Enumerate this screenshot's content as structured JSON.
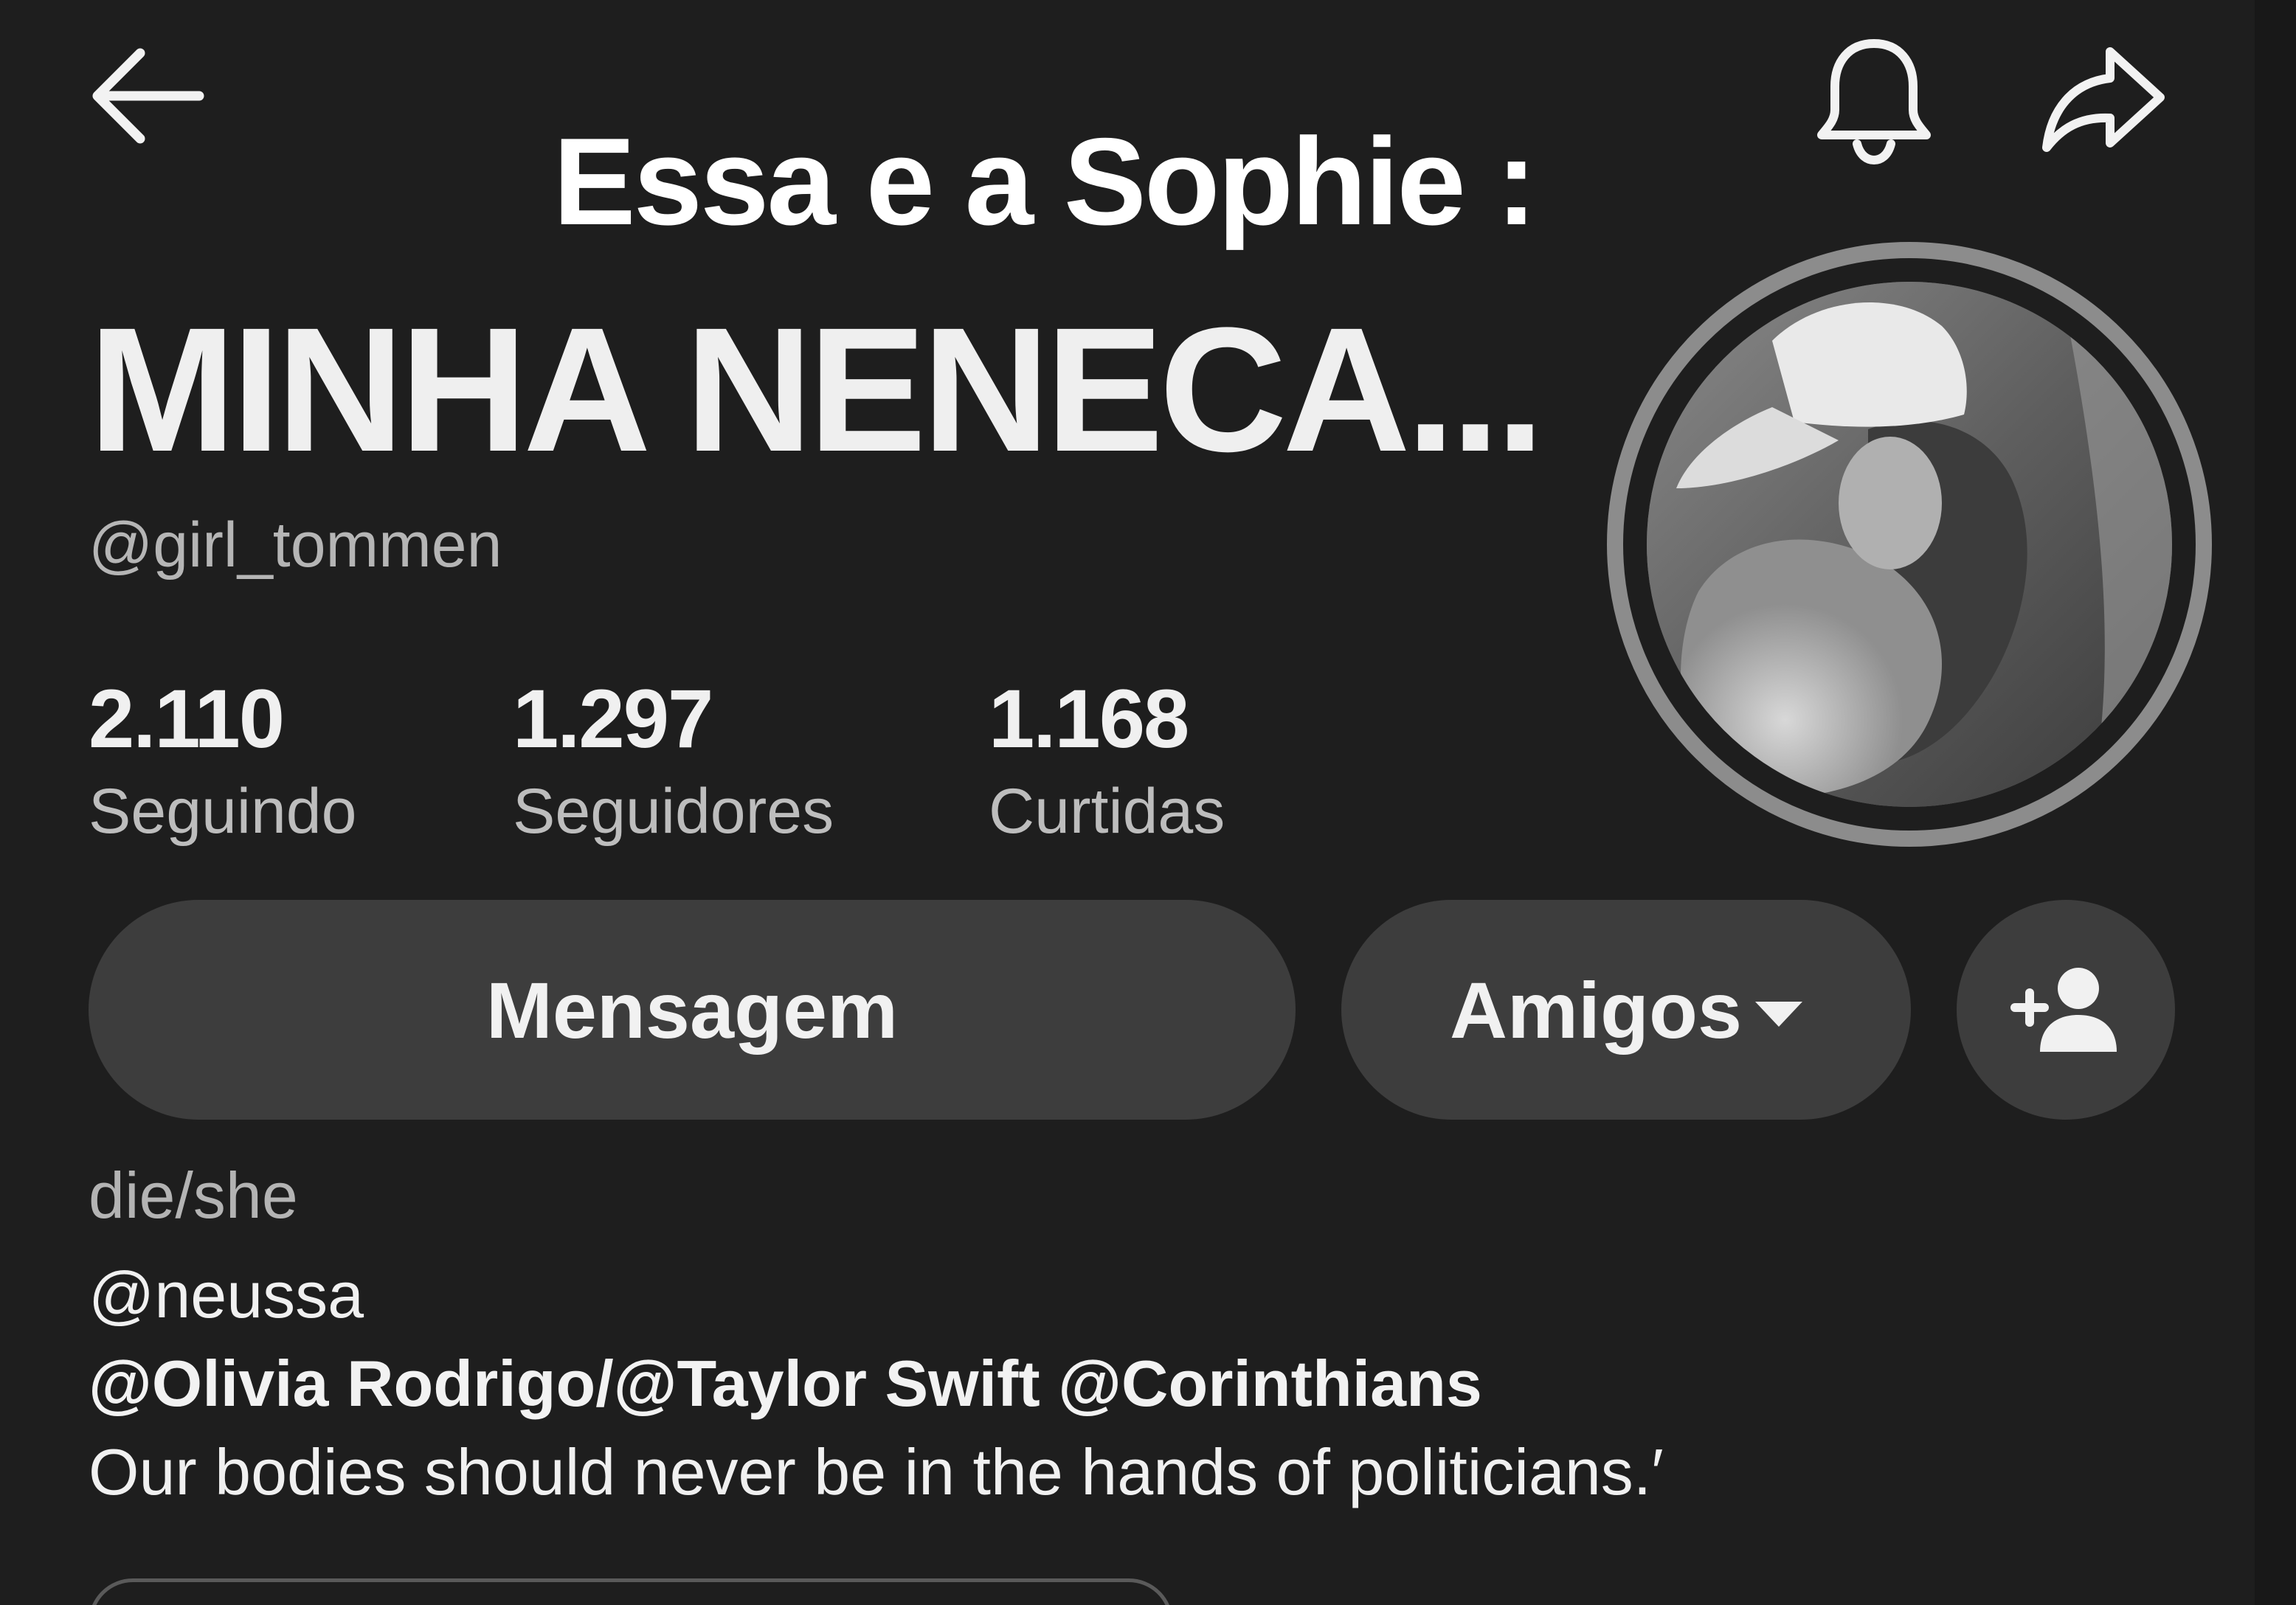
{
  "header": {
    "overlay_caption": "Essa e a Sophie :",
    "icons": [
      "back-arrow-icon",
      "bell-icon",
      "share-icon"
    ]
  },
  "profile": {
    "display_name": "MINHA NENECA...",
    "username": "@girl_tommen",
    "avatar_alt": "profile photo"
  },
  "stats": [
    {
      "value": "2.110",
      "label": "Seguindo"
    },
    {
      "value": "1.297",
      "label": "Seguidores"
    },
    {
      "value": "1.168",
      "label": "Curtidas"
    }
  ],
  "actions": {
    "message_label": "Mensagem",
    "friends_label": "Amigos",
    "add_friend_icon": "add-user-icon"
  },
  "bio": {
    "pronouns": "die/she",
    "mention": "@neussa",
    "links": "@Olivia Rodrigo/@Taylor Swift @Corinthians",
    "quote": "Our bodies should never be in the hands of politicians.′"
  },
  "colors": {
    "background": "#1e1e1e",
    "button": "#3d3d3d",
    "avatar_ring": "#8c8c8c",
    "muted_text": "#b5b5b5"
  }
}
